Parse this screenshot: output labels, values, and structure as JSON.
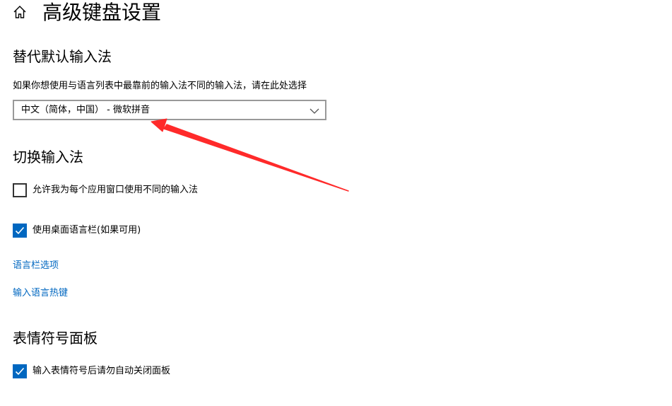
{
  "header": {
    "title": "高级键盘设置"
  },
  "override_input": {
    "heading": "替代默认输入法",
    "description": "如果你想使用与语言列表中最靠前的输入法不同的输入法，请在此处选择",
    "dropdown_value": "中文（简体，中国） - 微软拼音"
  },
  "switching": {
    "heading": "切换输入法",
    "per_app_label": "允许我为每个应用窗口使用不同的输入法",
    "per_app_checked": false,
    "desktop_bar_label": "使用桌面语言栏(如果可用)",
    "desktop_bar_checked": true,
    "language_bar_options_link": "语言栏选项",
    "hotkeys_link": "输入语言热键"
  },
  "emoji": {
    "heading": "表情符号面板",
    "close_panel_label": "输入表情符号后请勿自动关闭面板",
    "close_panel_checked": true
  },
  "colors": {
    "accent": "#0067c0",
    "annotation": "#ff2a2a"
  }
}
